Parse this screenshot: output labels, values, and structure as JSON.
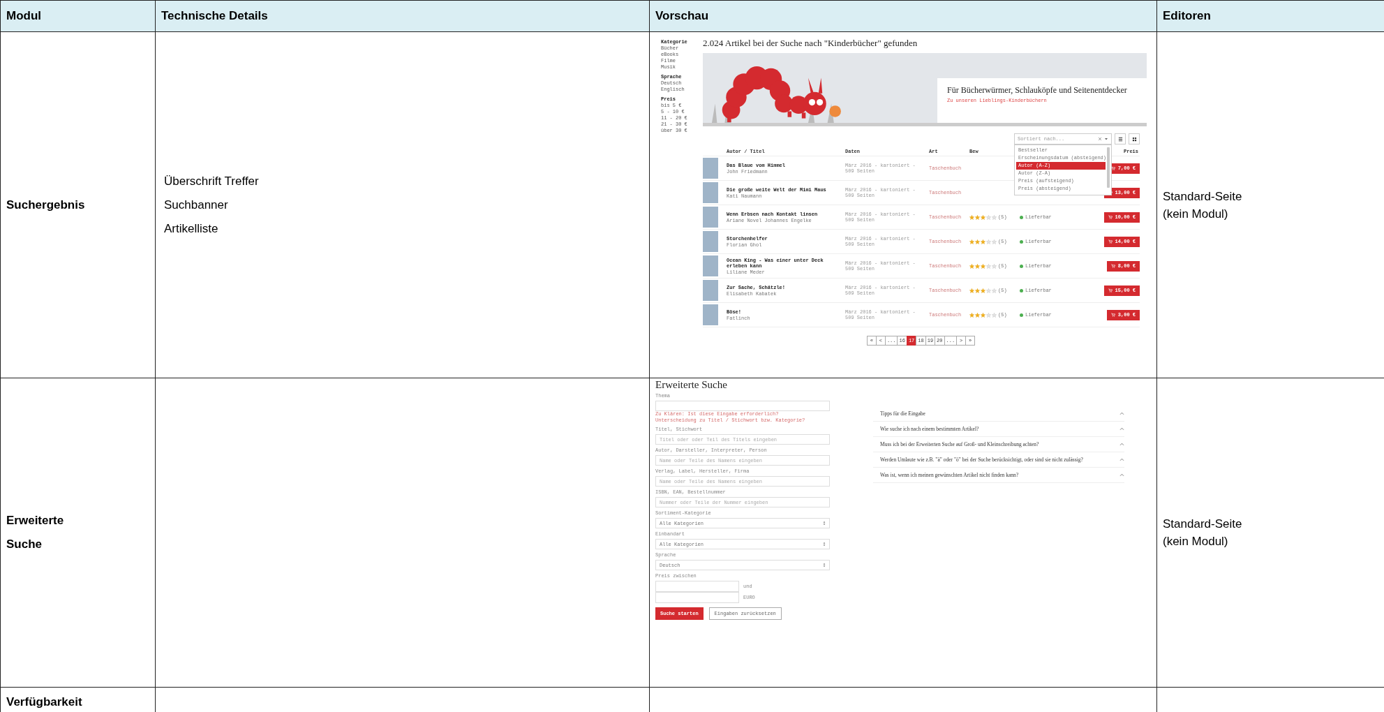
{
  "table": {
    "columns": [
      "Modul",
      "Technische Details",
      "Vorschau",
      "Editoren"
    ],
    "rows": [
      {
        "module": "Suchergebnis",
        "details": [
          "Überschrift Treffer",
          "Suchbanner",
          "Artikelliste"
        ],
        "editors": "Standard-Seite\n(kein Modul)",
        "preview": {
          "kind": "search_results",
          "sidebar": [
            {
              "title": "Kategorie",
              "items": [
                "Bücher",
                "eBooks",
                "Filme",
                "Musik"
              ]
            },
            {
              "title": "Sprache",
              "items": [
                "Deutsch",
                "Englisch"
              ]
            },
            {
              "title": "Preis",
              "items": [
                "bis 5 €",
                "5 - 10 €",
                "11 - 20 €",
                "21 - 30 €",
                "über 30 €"
              ]
            }
          ],
          "heading": "2.024 Artikel bei der Suche nach \"Kinderbücher\" gefunden",
          "banner": {
            "title": "Für Bücherwürmer, Schlauköpfe und Seitenentdecker",
            "link": "Zu unseren Lieblings-Kinderbüchern"
          },
          "sort": {
            "placeholder": "Sortiert nach...",
            "options": [
              {
                "label": "Bestseller",
                "selected": false
              },
              {
                "label": "Erscheinungsdatum (absteigend)",
                "selected": false
              },
              {
                "label": "Autor (A-Z)",
                "selected": true
              },
              {
                "label": "Autor (Z-A)",
                "selected": false
              },
              {
                "label": "Preis (aufsteigend)",
                "selected": false
              },
              {
                "label": "Preis (absteigend)",
                "selected": false
              }
            ]
          },
          "columns": [
            "Autor / Titel",
            "Daten",
            "Art",
            "Bew",
            "Preis"
          ],
          "items": [
            {
              "title": "Das Blaue vom Himmel",
              "author": "John Friedmann",
              "details": "März 2016 - kartoniert - 509 Seiten",
              "format": "Taschenbuch",
              "price": "7,00 €"
            },
            {
              "title": "Die große weite Welt der Mimi Maus",
              "author": "Kati Naumann",
              "details": "März 2016 - kartoniert - 509 Seiten",
              "format": "Taschenbuch",
              "price": "13,00 €"
            },
            {
              "title": "Wenn Erbsen nach Kontakt linsen",
              "author": "Ariane Novel Johannes Engelke",
              "details": "März 2016 - kartoniert - 509 Seiten",
              "format": "Taschenbuch",
              "stars": 3,
              "rating_count": "(5)",
              "availability": "Lieferbar",
              "price": "10,00 €"
            },
            {
              "title": "Storchenhelfer",
              "author": "Florian Ghol",
              "details": "März 2016 - kartoniert - 509 Seiten",
              "format": "Taschenbuch",
              "stars": 3,
              "rating_count": "(5)",
              "availability": "Lieferbar",
              "price": "14,00 €"
            },
            {
              "title": "Ocean King - Was einer unter Deck erleben kann",
              "author": "Liliane Meder",
              "details": "März 2016 - kartoniert - 509 Seiten",
              "format": "Taschenbuch",
              "stars": 3,
              "rating_count": "(5)",
              "availability": "Lieferbar",
              "price": "8,00 €"
            },
            {
              "title": "Zur Sache, Schätzle!",
              "author": "Elisabeth Kabatek",
              "details": "März 2016 - kartoniert - 509 Seiten",
              "format": "Taschenbuch",
              "stars": 3,
              "rating_count": "(5)",
              "availability": "Lieferbar",
              "price": "15,00 €"
            },
            {
              "title": "Böse!",
              "author": "Fatlinch",
              "details": "März 2016 - kartoniert - 509 Seiten",
              "format": "Taschenbuch",
              "stars": 3,
              "rating_count": "(5)",
              "availability": "Lieferbar",
              "price": "3,00 €"
            }
          ],
          "pagination": [
            {
              "label": "«",
              "selected": false
            },
            {
              "label": "<",
              "selected": false
            },
            {
              "label": "...",
              "selected": false
            },
            {
              "label": "16",
              "selected": false
            },
            {
              "label": "17",
              "selected": true
            },
            {
              "label": "18",
              "selected": false
            },
            {
              "label": "19",
              "selected": false
            },
            {
              "label": "20",
              "selected": false
            },
            {
              "label": "...",
              "selected": false
            },
            {
              "label": ">",
              "selected": false
            },
            {
              "label": "»",
              "selected": false
            }
          ]
        }
      },
      {
        "module": "Erweiterte Suche",
        "editors": "Standard-Seite\n(kein Modul)",
        "preview": {
          "kind": "advanced_search",
          "title": "Erweiterte Suche",
          "fields": [
            {
              "kind": "text",
              "label": "Thema",
              "notes": [
                "Zu Klären: Ist diese Eingabe erforderlich?",
                "Unterscheidung zu Titel / Stichwort bzw. Kategorie?"
              ]
            },
            {
              "kind": "text",
              "label": "Titel, Stichwort",
              "placeholder": "Titel oder oder Teil des Titels eingeben"
            },
            {
              "kind": "text",
              "label": "Autor, Darsteller, Interpreter, Person",
              "placeholder": "Name oder Teile des Namens eingeben"
            },
            {
              "kind": "text",
              "label": "Verlag, Label, Hersteller, Firma",
              "placeholder": "Name oder Teile des Namens eingeben"
            },
            {
              "kind": "text",
              "label": "ISBN, EAN, Bestellnummer",
              "placeholder": "Nummer oder Teile der Nummer eingeben"
            },
            {
              "kind": "select",
              "label": "Sortiment-Kategorie",
              "value": "Alle Kategorien"
            },
            {
              "kind": "select",
              "label": "Einbandart",
              "value": "Alle Kategorien"
            },
            {
              "kind": "select",
              "label": "Sprache",
              "value": "Deutsch"
            },
            {
              "kind": "range",
              "label": "Preis zwischen",
              "between": "und",
              "unit": "EURO"
            }
          ],
          "buttons": [
            {
              "kind": "primary",
              "label": "Suche starten"
            },
            {
              "kind": "secondary",
              "label": "Eingaben zurücksetzen"
            }
          ],
          "faq": [
            "Tipps für die Eingabe",
            "Wie suche ich nach einem bestimmten Artikel?",
            "Muss ich bei der Erweiterten Suche auf Groß- und Kleinschreibung achten?",
            "Werden Umlaute wie z.B. \"ä\" oder \"ö\" bei der Suche berücksichtigt, oder sind sie nicht zulässig?",
            "Was ist, wenn ich meinen gewünschten Artikel nicht finden kann?"
          ]
        }
      },
      {
        "module": "Verfügbarkeit"
      }
    ]
  }
}
